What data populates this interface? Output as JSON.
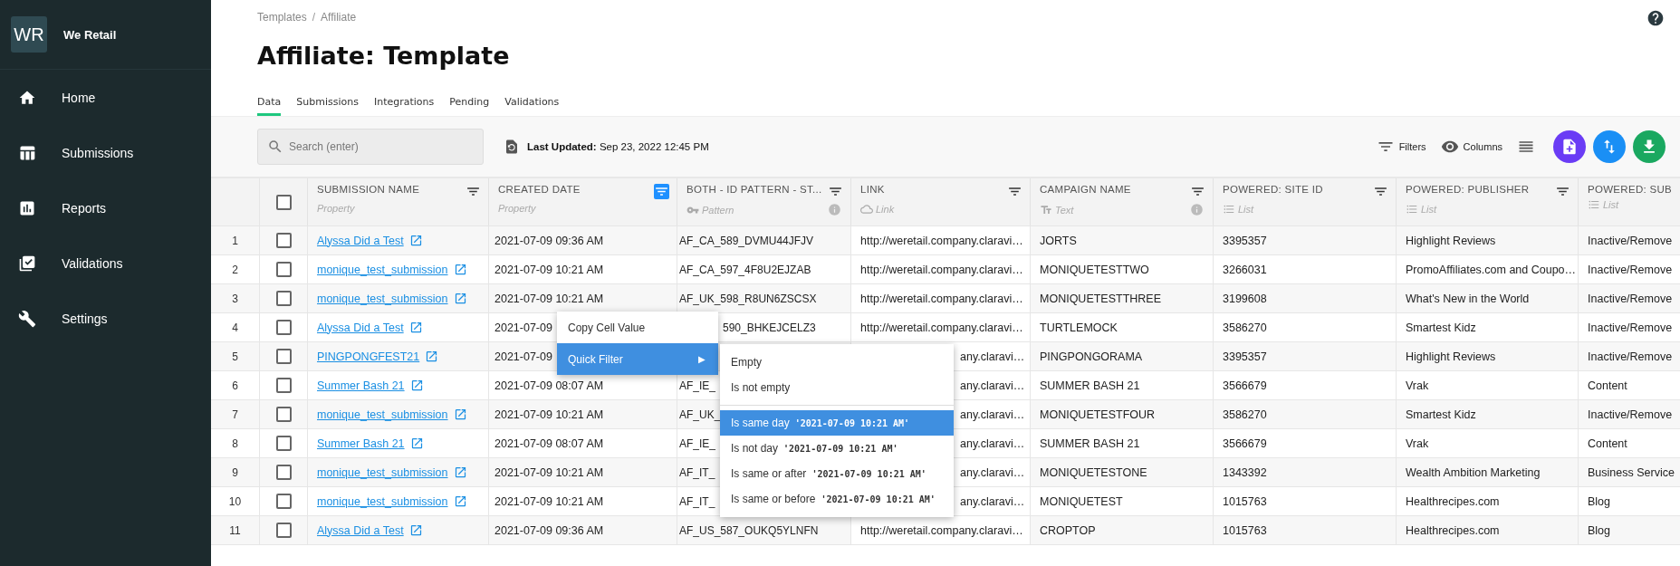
{
  "sidebar": {
    "logo": "WR",
    "brand": "We Retail",
    "items": [
      {
        "label": "Home",
        "selected": false
      },
      {
        "label": "Submissions",
        "selected": false
      },
      {
        "label": "Reports",
        "selected": false
      },
      {
        "label": "Validations",
        "selected": false
      },
      {
        "label": "Settings",
        "selected": false
      }
    ]
  },
  "breadcrumbs": [
    "Templates",
    "Affiliate"
  ],
  "breadcrumb_separator": "/",
  "title": "Affiliate: Template",
  "tabs": [
    {
      "label": "Data",
      "selected": true
    },
    {
      "label": "Submissions",
      "selected": false
    },
    {
      "label": "Integrations",
      "selected": false
    },
    {
      "label": "Pending",
      "selected": false
    },
    {
      "label": "Validations",
      "selected": false
    }
  ],
  "toolbar": {
    "search_placeholder": "Search (enter)",
    "last_updated_label": "Last Updated:",
    "last_updated_value": "Sep 23, 2022 12:45 PM",
    "filters": "Filters",
    "columns": "Columns"
  },
  "table": {
    "select_all_checked": false,
    "columns": [
      {
        "name": "SUBMISSION NAME",
        "type": "Property",
        "info": false,
        "filter_active": false
      },
      {
        "name": "CREATED DATE",
        "type": "Property",
        "info": false,
        "filter_active": true
      },
      {
        "name": "BOTH - ID PATTERN - ST...",
        "type": "Pattern",
        "info": true,
        "filter_active": false
      },
      {
        "name": "LINK",
        "type": "Link",
        "info": false,
        "filter_active": false
      },
      {
        "name": "CAMPAIGN NAME",
        "type": "Text",
        "info": true,
        "filter_active": false
      },
      {
        "name": "POWERED: SITE ID",
        "type": "List",
        "info": false,
        "filter_active": false
      },
      {
        "name": "POWERED: PUBLISHER",
        "type": "List",
        "info": false,
        "filter_active": false
      },
      {
        "name": "POWERED: SUB",
        "type": "List",
        "info": false
      }
    ],
    "rows": [
      {
        "number": "1",
        "checked": false,
        "cells": [
          "Alyssa Did a Test",
          "2021-07-09 09:36 AM",
          "AF_CA_589_DVMU44JFJV",
          "http://weretail.company.claravi…",
          "JORTS",
          "3395357",
          "Highlight Reviews",
          "Inactive/Remove"
        ]
      },
      {
        "number": "2",
        "checked": false,
        "cells": [
          "monique_test_submission",
          "2021-07-09 10:21 AM",
          "AF_CA_597_4F8U2EJZAB",
          "http://weretail.company.claravi…",
          "MONIQUETESTTWO",
          "3266031",
          "PromoAffiliates.com and Coupo…",
          "Inactive/Remove"
        ]
      },
      {
        "number": "3",
        "checked": false,
        "cells": [
          "monique_test_submission",
          "2021-07-09 10:21 AM",
          "AF_UK_598_R8UN6ZSCSX",
          "http://weretail.company.claravi…",
          "MONIQUETESTTHREE",
          "3199608",
          "What's New in the World",
          "Inactive/Remove"
        ]
      },
      {
        "number": "4",
        "checked": false,
        "cells": [
          "Alyssa Did a Test",
          "2021-07-09",
          "590_BHKEJCELZ3",
          "http://weretail.company.claravi…",
          "TURTLEMOCK",
          "3586270",
          "Smartest Kidz",
          "Inactive/Remove"
        ]
      },
      {
        "number": "5",
        "checked": false,
        "cells": [
          "PINGPONGFEST21",
          "2021-07-09",
          null,
          "any.claravi…",
          "PINGPONGORAMA",
          "3395357",
          "Highlight Reviews",
          "Inactive/Remove"
        ]
      },
      {
        "number": "6",
        "checked": false,
        "cells": [
          "Summer Bash 21",
          "2021-07-09 08:07 AM",
          "AF_IE_",
          "any.claravi…",
          "SUMMER BASH 21",
          "3566679",
          "Vrak",
          "Content"
        ]
      },
      {
        "number": "7",
        "checked": false,
        "cells": [
          "monique_test_submission",
          "2021-07-09 10:21 AM",
          "AF_UK_",
          "any.claravi…",
          "MONIQUETESTFOUR",
          "3586270",
          "Smartest Kidz",
          "Inactive/Remove"
        ]
      },
      {
        "number": "8",
        "checked": false,
        "cells": [
          "Summer Bash 21",
          "2021-07-09 08:07 AM",
          "AF_IE_",
          "any.claravi…",
          "SUMMER BASH 21",
          "3566679",
          "Vrak",
          "Content"
        ]
      },
      {
        "number": "9",
        "checked": false,
        "cells": [
          "monique_test_submission",
          "2021-07-09 10:21 AM",
          "AF_IT_",
          "any.claravi…",
          "MONIQUETESTONE",
          "1343392",
          "Wealth Ambition Marketing",
          "Business Service"
        ]
      },
      {
        "number": "10",
        "checked": false,
        "cells": [
          "monique_test_submission",
          "2021-07-09 10:21 AM",
          "AF_IT_",
          "any.claravi…",
          "MONIQUETEST",
          "1015763",
          "Healthrecipes.com",
          "Blog"
        ]
      },
      {
        "number": "11",
        "checked": false,
        "cells": [
          "Alyssa Did a Test",
          "2021-07-09 09:36 AM",
          "AF_US_587_OUKQ5YLNFN",
          "http://weretail.company.claravi…",
          "CROPTOP",
          "1015763",
          "Healthrecipes.com",
          "Blog"
        ]
      }
    ]
  },
  "context_menu": {
    "items": [
      {
        "label": "Copy Cell Value",
        "selected": false
      },
      {
        "label": "Quick Filter",
        "arrow": "▶",
        "selected": true
      }
    ]
  },
  "quick_filter_menu": {
    "items": [
      {
        "label": "Empty",
        "selected": false
      },
      {
        "label": "Is not empty",
        "selected": false
      },
      {
        "kind": "divider"
      },
      {
        "label": "Is same day",
        "value": "'2021-07-09 10:21 AM'",
        "selected": true
      },
      {
        "label": "Is not day",
        "value": "'2021-07-09 10:21 AM'",
        "selected": false
      },
      {
        "label": "Is same or after",
        "value": "'2021-07-09 10:21 AM'",
        "selected": false
      },
      {
        "label": "Is same or before",
        "value": "'2021-07-09 10:21 AM'",
        "selected": false
      }
    ]
  }
}
